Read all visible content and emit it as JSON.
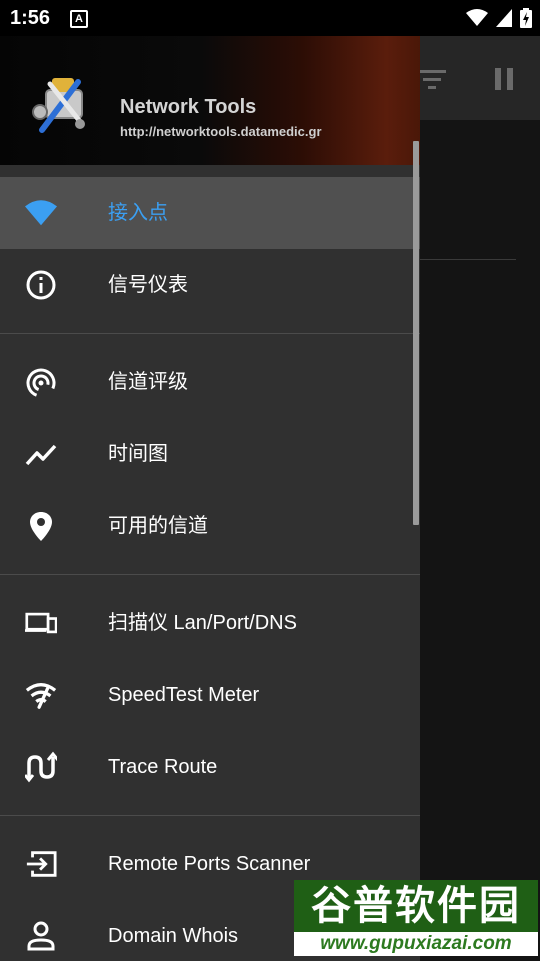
{
  "status_bar": {
    "time": "1:56",
    "notification_letter": "A"
  },
  "header": {
    "title": "Network Tools",
    "url": "http://networktools.datamedic.gr"
  },
  "menu": {
    "groups": [
      [
        {
          "label": "接入点",
          "icon": "wifi-icon",
          "active": true
        },
        {
          "label": "信号仪表",
          "icon": "info-icon",
          "active": false
        }
      ],
      [
        {
          "label": "信道评级",
          "icon": "radar-icon",
          "active": false
        },
        {
          "label": "时间图",
          "icon": "timeline-icon",
          "active": false
        },
        {
          "label": "可用的信道",
          "icon": "location-pin-icon",
          "active": false
        }
      ],
      [
        {
          "label": "扫描仪 Lan/Port/DNS",
          "icon": "devices-icon",
          "active": false
        },
        {
          "label": "SpeedTest Meter",
          "icon": "wifi-speed-icon",
          "active": false
        },
        {
          "label": "Trace Route",
          "icon": "route-icon",
          "active": false
        }
      ],
      [
        {
          "label": "Remote Ports Scanner",
          "icon": "input-icon",
          "active": false
        },
        {
          "label": "Domain Whois",
          "icon": "person-icon",
          "active": false
        }
      ]
    ]
  },
  "watermark": {
    "title": "谷普软件园",
    "url": "www.gupuxiazai.com"
  },
  "colors": {
    "accent": "#3b9ff2",
    "drawer_bg": "#303030",
    "active_bg": "#505050"
  }
}
